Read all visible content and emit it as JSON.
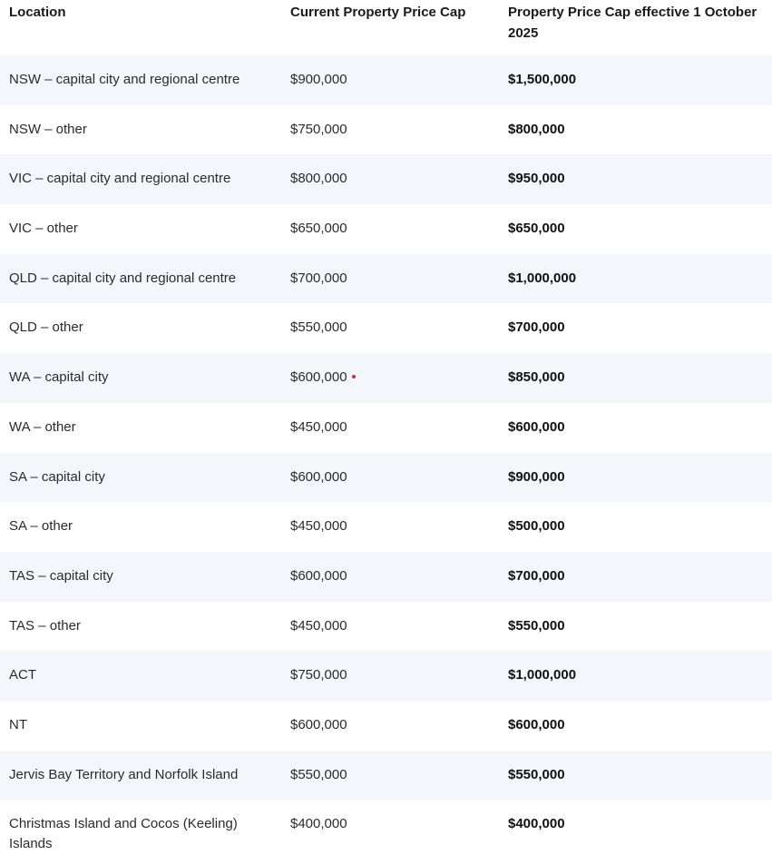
{
  "table": {
    "headers": {
      "location": "Location",
      "current": "Current Property Price Cap",
      "effective": "Property Price Cap effective 1 October 2025"
    },
    "rows": [
      {
        "location": "NSW – capital city and regional centre",
        "current": "$900,000",
        "effective": "$1,500,000"
      },
      {
        "location": "NSW – other",
        "current": "$750,000",
        "effective": "$800,000"
      },
      {
        "location": "VIC – capital city and regional centre",
        "current": "$800,000",
        "effective": "$950,000"
      },
      {
        "location": "VIC – other",
        "current": "$650,000",
        "effective": "$650,000"
      },
      {
        "location": "QLD – capital city and regional centre",
        "current": "$700,000",
        "effective": "$1,000,000"
      },
      {
        "location": "QLD – other",
        "current": "$550,000",
        "effective": "$700,000"
      },
      {
        "location": "WA – capital city",
        "current": "$600,000",
        "effective": "$850,000"
      },
      {
        "location": "WA – other",
        "current": "$450,000",
        "effective": "$600,000"
      },
      {
        "location": "SA – capital city",
        "current": "$600,000",
        "effective": "$900,000"
      },
      {
        "location": "SA – other",
        "current": "$450,000",
        "effective": "$500,000"
      },
      {
        "location": "TAS – capital city",
        "current": "$600,000",
        "effective": "$700,000"
      },
      {
        "location": "TAS – other",
        "current": "$450,000",
        "effective": "$550,000"
      },
      {
        "location": "ACT",
        "current": "$750,000",
        "effective": "$1,000,000"
      },
      {
        "location": "NT",
        "current": "$600,000",
        "effective": "$600,000"
      },
      {
        "location": "Jervis Bay Territory and Norfolk Island",
        "current": "$550,000",
        "effective": "$550,000"
      },
      {
        "location": "Christmas Island and Cocos (Keeling) Islands",
        "current": "$400,000",
        "effective": "$400,000"
      }
    ]
  },
  "colors": {
    "row_shade": "#f3f7fb",
    "marker": "#d0302f"
  }
}
